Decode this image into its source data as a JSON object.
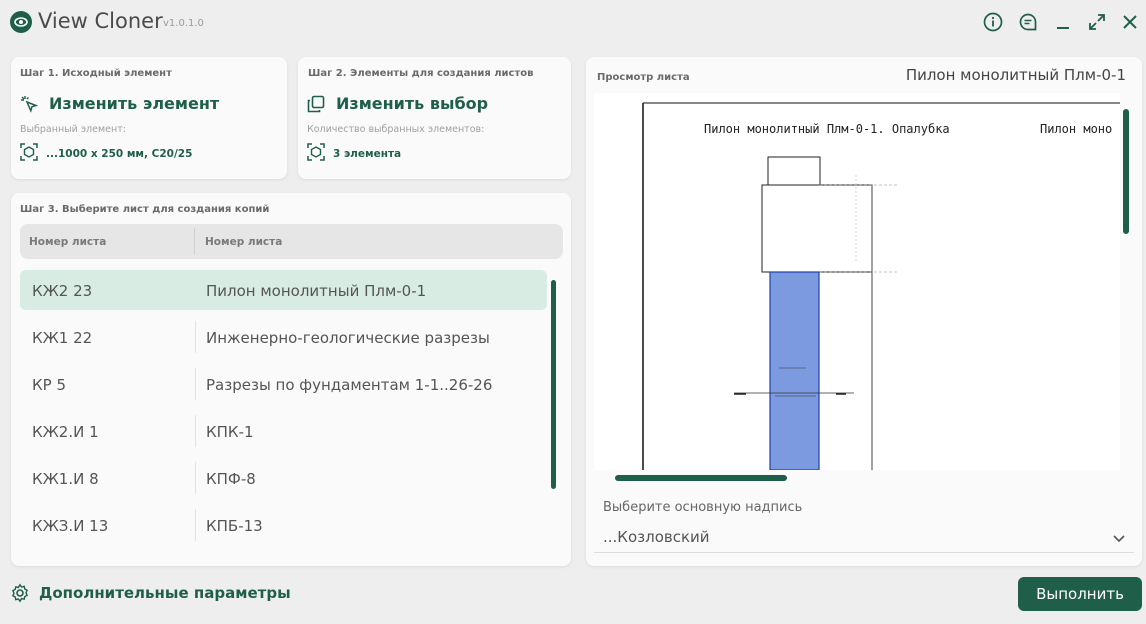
{
  "app": {
    "title": "View Cloner",
    "version": "v1.0.1.0"
  },
  "step1": {
    "title": "Шаг 1. Исходный элемент",
    "action": "Изменить элемент",
    "sublabel": "Выбранный элемент:",
    "value": "...1000 x 250 мм, C20/25"
  },
  "step2": {
    "title": "Шаг 2. Элементы для создания листов",
    "action": "Изменить выбор",
    "sublabel": "Количество выбранных элементов:",
    "value": "3 элемента"
  },
  "step3": {
    "title": "Шаг 3. Выберите лист для создания копий",
    "columns": [
      "Номер листа",
      "Номер листа"
    ],
    "rows": [
      {
        "number": "КЖ2 23",
        "name": "Пилон монолитный Плм-0-1",
        "selected": true
      },
      {
        "number": "КЖ1 22",
        "name": "Инженерно-геологические разрезы",
        "selected": false
      },
      {
        "number": "КР 5",
        "name": "Разрезы по фундаментам 1-1..26-26",
        "selected": false
      },
      {
        "number": "КЖ2.И 1",
        "name": "КПК-1",
        "selected": false
      },
      {
        "number": "КЖ1.И 8",
        "name": "КПФ-8",
        "selected": false
      },
      {
        "number": "КЖЗ.И 13",
        "name": "КПБ-13",
        "selected": false
      }
    ]
  },
  "preview": {
    "label": "Просмотр листа",
    "sheet_name": "Пилон монолитный Плм-0-1",
    "drawing_title": "Пилон монолитный Плм-0-1. Опалубка",
    "drawing_title_2": "Пилон моно"
  },
  "title_block": {
    "label": "Выберите основную надпись",
    "value": "...Козловский"
  },
  "footer": {
    "extra_params": "Дополнительные параметры",
    "run_button": "Выполнить"
  },
  "colors": {
    "accent": "#1f5f4a",
    "selected_row": "#d8ece4",
    "pilon_fill": "#7b9ae0"
  },
  "icons": {
    "logo": "eye-logo-icon",
    "info": "info-icon",
    "chat": "chat-icon",
    "minimize": "minimize-icon",
    "expand": "expand-icon",
    "close": "close-icon",
    "select_element": "cursor-click-icon",
    "change_selection": "copy-icon",
    "element": "cube-icon",
    "settings": "gear-icon",
    "dropdown": "chevron-down-icon"
  }
}
